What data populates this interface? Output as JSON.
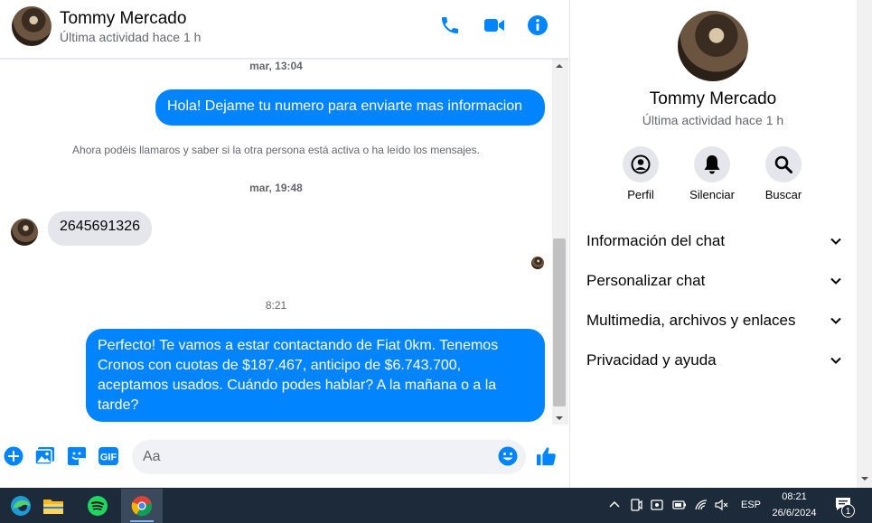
{
  "header": {
    "name": "Tommy Mercado",
    "status": "Última actividad hace 1 h"
  },
  "messages": {
    "ts1": "mar, 13:04",
    "out1": "Hola! Dejame tu numero para enviarte mas informacion",
    "system": "Ahora podéis llamaros y saber si la otra persona está activa o ha leído los mensajes.",
    "ts2": "mar, 19:48",
    "in1": "2645691326",
    "ts3": "8:21",
    "out2": "Perfecto! Te vamos a estar contactando de Fiat 0km. Tenemos Cronos con cuotas de $187.467, anticipo de $6.743.700, aceptamos usados. Cuándo podes hablar? A la mañana o a la tarde?"
  },
  "composer": {
    "placeholder": "Aa",
    "gif_label": "GIF"
  },
  "sidebar": {
    "name": "Tommy Mercado",
    "status": "Última actividad hace 1 h",
    "actions": [
      {
        "label": "Perfil",
        "icon": "profile-icon"
      },
      {
        "label": "Silenciar",
        "icon": "bell-icon"
      },
      {
        "label": "Buscar",
        "icon": "search-icon"
      }
    ],
    "sections": [
      {
        "label": "Información del chat"
      },
      {
        "label": "Personalizar chat"
      },
      {
        "label": "Multimedia, archivos y enlaces"
      },
      {
        "label": "Privacidad y ayuda"
      }
    ]
  },
  "taskbar": {
    "lang": "ESP",
    "time": "08:21",
    "date": "26/6/2024",
    "notif_count": "1"
  },
  "colors": {
    "accent": "#0084ff",
    "taskbar": "#1c2a3a"
  }
}
